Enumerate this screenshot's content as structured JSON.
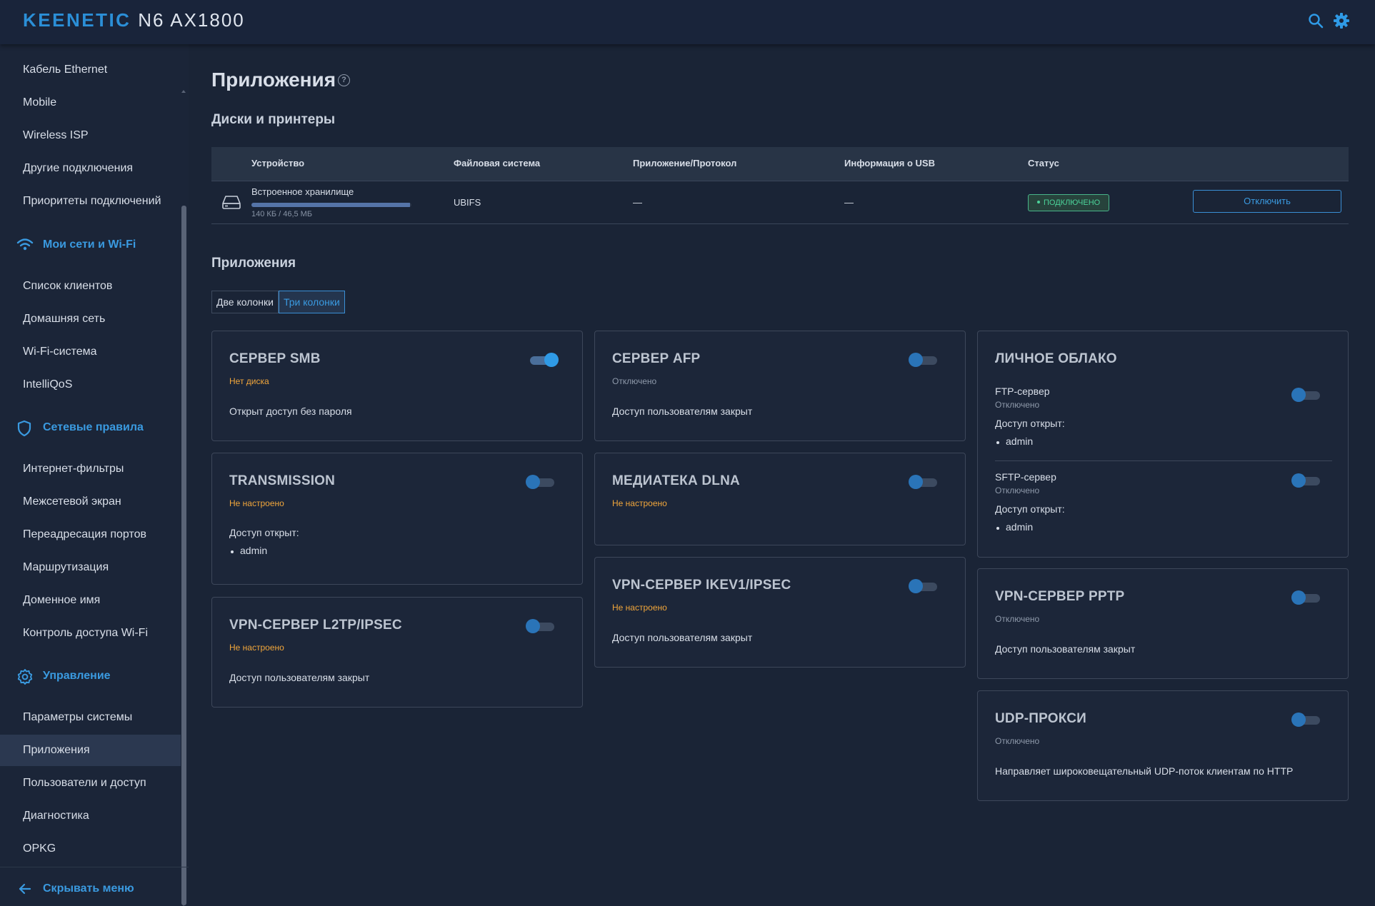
{
  "header": {
    "brand_part1": "KEENETIC",
    "brand_part2": "N6 AX1800",
    "search_icon": "search-icon",
    "settings_icon": "gear-icon",
    "accent_color": "#2b8fd7"
  },
  "sidebar": {
    "items_top": [
      "Кабель Ethernet",
      "Mobile",
      "Wireless ISP",
      "Другие подключения",
      "Приоритеты подключений"
    ],
    "section_wifi": "Мои сети и Wi-Fi",
    "items_wifi": [
      "Список клиентов",
      "Домашняя сеть",
      "Wi-Fi-система",
      "IntelliQoS"
    ],
    "section_rules": "Сетевые правила",
    "items_rules": [
      "Интернет-фильтры",
      "Межсетевой экран",
      "Переадресация портов",
      "Маршрутизация",
      "Доменное имя",
      "Контроль доступа Wi-Fi"
    ],
    "section_manage": "Управление",
    "items_manage": [
      "Параметры системы",
      "Приложения",
      "Пользователи и доступ",
      "Диагностика",
      "OPKG"
    ],
    "active_item": "Приложения",
    "hide_menu": "Скрывать меню"
  },
  "main": {
    "title": "Приложения",
    "help_icon": "?",
    "disks_title": "Диски и принтеры",
    "table": {
      "headers": [
        "Устройство",
        "Файловая система",
        "Приложение/Протокол",
        "Информация о USB",
        "Статус"
      ],
      "row": {
        "device": "Встроенное хранилище",
        "usage_text": "140 КБ / 46,5 МБ",
        "usage_fraction": 0.99,
        "filesystem": "UBIFS",
        "protocol": "—",
        "usb_info": "—",
        "status": "ПОДКЛЮЧЕНО",
        "action": "Отключить"
      }
    },
    "apps_title": "Приложения",
    "column_options": [
      "Две колонки",
      "Три колонки"
    ],
    "column_selected": "Три колонки",
    "apps": {
      "smb": {
        "title": "СЕРВЕР SMB",
        "status": "Нет диска",
        "desc": "Открыт доступ без пароля",
        "enabled": true
      },
      "afp": {
        "title": "СЕРВЕР AFP",
        "status": "Отключено",
        "desc": "Доступ пользователям закрыт",
        "enabled": false
      },
      "cloud": {
        "title": "ЛИЧНОЕ ОБЛАКО",
        "ftp": {
          "name": "FTP-сервер",
          "status": "Отключено",
          "access_label": "Доступ открыт:",
          "users": [
            "admin"
          ],
          "enabled": false
        },
        "sftp": {
          "name": "SFTP-сервер",
          "status": "Отключено",
          "access_label": "Доступ открыт:",
          "users": [
            "admin"
          ],
          "enabled": false
        }
      },
      "transmission": {
        "title": "TRANSMISSION",
        "status": "Не настроено",
        "access_label": "Доступ открыт:",
        "users": [
          "admin"
        ],
        "enabled": false
      },
      "dlna": {
        "title": "МЕДИАТЕКА DLNA",
        "status": "Не настроено",
        "enabled": false
      },
      "ikev": {
        "title": "VPN-СЕРВЕР IKEV1/IPSEC",
        "status": "Не настроено",
        "desc": "Доступ пользователям закрыт",
        "enabled": false
      },
      "pptp": {
        "title": "VPN-СЕРВЕР PPTP",
        "status": "Отключено",
        "desc": "Доступ пользователям закрыт",
        "enabled": false
      },
      "l2tp": {
        "title": "VPN-СЕРВЕР L2TP/IPSEC",
        "status": "Не настроено",
        "desc": "Доступ пользователям закрыт",
        "enabled": false
      },
      "udp": {
        "title": "UDP-ПРОКСИ",
        "status": "Отключено",
        "desc": "Направляет широковещательный UDP-поток клиентам по HTTP",
        "enabled": false
      }
    }
  }
}
